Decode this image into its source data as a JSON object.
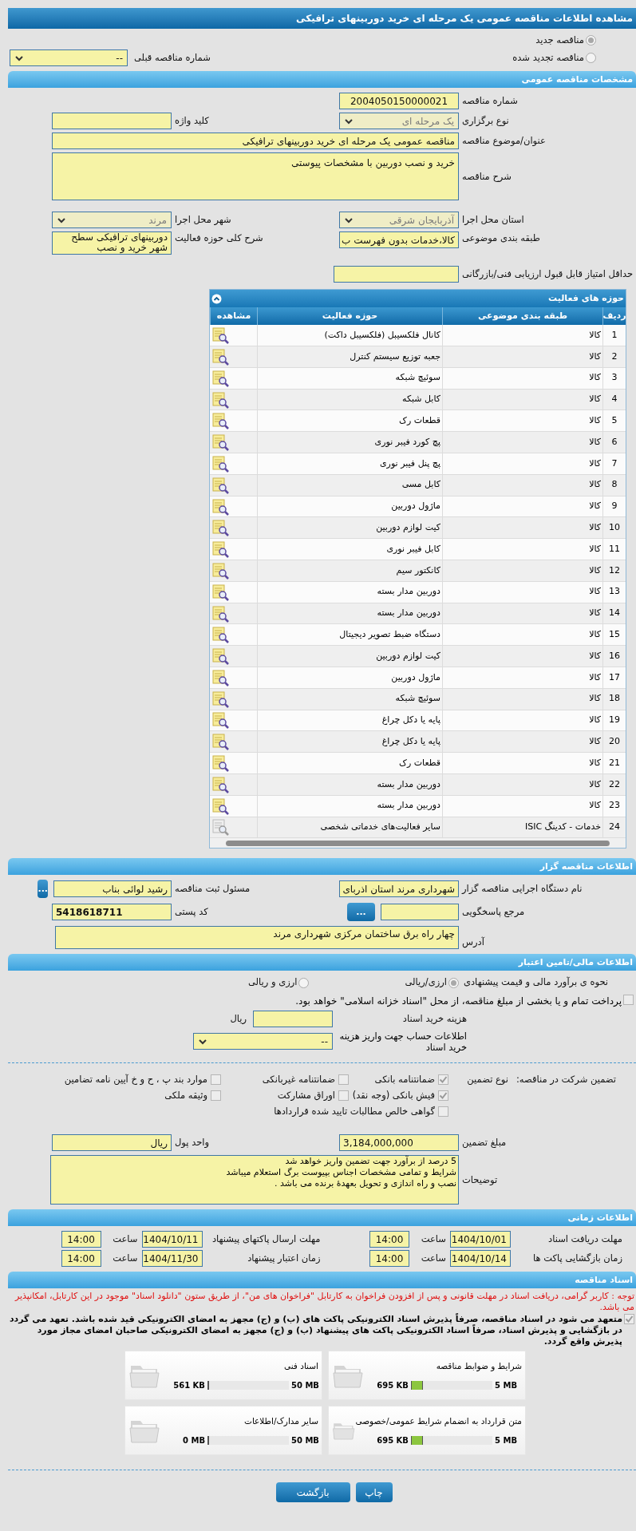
{
  "title": "مشاهده اطلاعات مناقصه عمومی یک مرحله ای خرید دوربینهای ترافیکی",
  "tender_types": [
    {
      "label": "مناقصه جدید",
      "selected": true
    },
    {
      "label": "مناقصه تجدید شده",
      "selected": false
    }
  ],
  "previous_tender": {
    "label": "شماره مناقصه قبلی",
    "value": "--",
    "disabled": false
  },
  "general": {
    "header": "مشخصات مناقصه عمومی",
    "tender_number": {
      "label": "شماره مناقصه",
      "value": "2004050150000021"
    },
    "holding_type": {
      "label": "نوع برگزاری",
      "value": "یک مرحله ای",
      "disabled": true
    },
    "keyword": {
      "label": "کلید واژه"
    },
    "subject": {
      "label": "عنوان/موضوع مناقصه",
      "value": "مناقصه عمومی یک مرحله ای خرید دوربینهای ترافیکی"
    },
    "description": {
      "label": "شرح مناقصه",
      "value": "خرید و نصب دوربین با مشخصات پیوستی"
    },
    "province": {
      "label": "استان محل اجرا",
      "value": "آذربایجان شرقی",
      "disabled": true
    },
    "city": {
      "label": "شهر محل اجرا",
      "value": "مرند",
      "disabled": true
    },
    "category": {
      "label": "طبقه بندی موضوعی",
      "value": "کالا،خدمات بدون فهرست ب"
    },
    "activity_scope": {
      "label": "شرح کلی حوزه فعالیت",
      "value": "دوربینهای ترافیکی سطح شهر خرید و نصب"
    },
    "min_score": {
      "label": "حداقل امتیاز قابل قبول ارزیابی فنی/بازرگانی"
    }
  },
  "activities": {
    "header": "حوزه های فعالیت",
    "columns": [
      "ردیف",
      "طبقه بندی موضوعی",
      "حوزه فعالیت",
      "مشاهده"
    ],
    "rows": [
      {
        "number": "1",
        "category": "کالا",
        "activity": "کانال فلکسیبل (فلکسیبل داکت)",
        "disabled": false
      },
      {
        "number": "2",
        "category": "کالا",
        "activity": "جعبه توزیع سیستم کنترل",
        "disabled": false
      },
      {
        "number": "3",
        "category": "کالا",
        "activity": "سوئیچ شبکه",
        "disabled": false
      },
      {
        "number": "4",
        "category": "کالا",
        "activity": "کابل شبکه",
        "disabled": false
      },
      {
        "number": "5",
        "category": "کالا",
        "activity": "قطعات رک",
        "disabled": false
      },
      {
        "number": "6",
        "category": "کالا",
        "activity": "پچ کورد فیبر نوری",
        "disabled": false
      },
      {
        "number": "7",
        "category": "کالا",
        "activity": "پچ پنل فیبر نوری",
        "disabled": false
      },
      {
        "number": "8",
        "category": "کالا",
        "activity": "کابل مسی",
        "disabled": false
      },
      {
        "number": "9",
        "category": "کالا",
        "activity": "ماژول دوربین",
        "disabled": false
      },
      {
        "number": "10",
        "category": "کالا",
        "activity": "کیت لوازم دوربین",
        "disabled": false
      },
      {
        "number": "11",
        "category": "کالا",
        "activity": "کابل فیبر نوری",
        "disabled": false
      },
      {
        "number": "12",
        "category": "کالا",
        "activity": "کانکتور سیم",
        "disabled": false
      },
      {
        "number": "13",
        "category": "کالا",
        "activity": "دوربین مدار بسته",
        "disabled": false
      },
      {
        "number": "14",
        "category": "کالا",
        "activity": "دوربین مدار بسته",
        "disabled": false
      },
      {
        "number": "15",
        "category": "کالا",
        "activity": "دستگاه ضبط تصویر دیجیتال",
        "disabled": false
      },
      {
        "number": "16",
        "category": "کالا",
        "activity": "کیت لوازم دوربین",
        "disabled": false
      },
      {
        "number": "17",
        "category": "کالا",
        "activity": "ماژول دوربین",
        "disabled": false
      },
      {
        "number": "18",
        "category": "کالا",
        "activity": "سوئیچ شبکه",
        "disabled": false
      },
      {
        "number": "19",
        "category": "کالا",
        "activity": "پایه یا دکل چراغ",
        "disabled": false
      },
      {
        "number": "20",
        "category": "کالا",
        "activity": "پایه یا دکل چراغ",
        "disabled": false
      },
      {
        "number": "21",
        "category": "کالا",
        "activity": "قطعات رک",
        "disabled": false
      },
      {
        "number": "22",
        "category": "کالا",
        "activity": "دوربین مدار بسته",
        "disabled": false
      },
      {
        "number": "23",
        "category": "کالا",
        "activity": "دوربین مدار بسته",
        "disabled": false
      },
      {
        "number": "24",
        "category": "خدمات - کدینگ ISIC",
        "activity": "سایر فعالیت‌های خدماتی شخصی",
        "disabled": true
      }
    ]
  },
  "organizer": {
    "header": "اطلاعات مناقصه گزار",
    "agency": {
      "label": "نام دستگاه اجرایی مناقصه گزار",
      "value": "شهرداری مرند استان اذربای"
    },
    "registrar": {
      "label": "مسئول ثبت مناقصه",
      "value": "رشید لوائی بناب",
      "button": "..."
    },
    "reference": {
      "label": "مرجع پاسخگویی",
      "button": "..."
    },
    "postal_code": {
      "label": "کد پستی",
      "value": "5418618711"
    },
    "address": {
      "label": "آدرس",
      "value": "چهار راه برق ساختمان مرکزی شهرداری مرند"
    }
  },
  "finance": {
    "header": "اطلاعات مالی/تامین اعتبار",
    "estimate": {
      "label": "نحوه ی برآورد مالی و قیمت پیشنهادی",
      "options": [
        {
          "label": "ارزی/ریالی",
          "selected": true
        },
        {
          "label": "ارزی و ریالی",
          "selected": false
        }
      ]
    },
    "treasury": {
      "label": "پرداخت تمام و یا بخشی از مبلغ مناقصه، از محل \"اسناد خزانه اسلامی\" خواهد بود.",
      "checked": false
    },
    "doc_fee": {
      "label": "هزینه خرید اسناد",
      "unit": "ریال"
    },
    "account": {
      "label": "اطلاعات حساب جهت واریز هزینه خرید اسناد",
      "value": "--",
      "disabled": false
    }
  },
  "guarantee": {
    "label": "تضمین شرکت در مناقصه:",
    "type_label": "نوع تضمین",
    "options": [
      {
        "label": "ضمانتنامه بانکی",
        "checked": true
      },
      {
        "label": "ضمانتنامه غیربانکی",
        "checked": false
      },
      {
        "label": "موارد بند پ ، ح و خ آیین نامه تضامین",
        "checked": false
      },
      {
        "label": "فیش بانکی (وجه نقد)",
        "checked": true
      },
      {
        "label": "اوراق مشارکت",
        "checked": false
      },
      {
        "label": "وثیقه ملکی",
        "checked": false
      },
      {
        "label": "گواهی خالص مطالبات تایید شده قراردادها",
        "checked": false
      }
    ],
    "amount": {
      "label": "مبلغ تضمین",
      "value": "3,184,000,000"
    },
    "currency": {
      "label": "واحد پول",
      "value": "ریال"
    },
    "notes": {
      "label": "توضیحات",
      "lines": [
        "5 درصد از برآورد جهت تضمین واریز خواهد شد",
        "شرایط و تمامی مشخصات اجناس بپیوست برگ استعلام میباشد",
        "نصب و راه اندازی و تحویل بعهدهٔ برنده می باشد ."
      ]
    }
  },
  "times": {
    "header": "اطلاعات زمانی",
    "items": [
      {
        "label": "مهلت دریافت اسناد",
        "date": "1404/10/01",
        "time_label": "ساعت",
        "time": "14:00"
      },
      {
        "label": "مهلت ارسال پاکتهای پیشنهاد",
        "date": "1404/10/11",
        "time_label": "ساعت",
        "time": "14:00"
      },
      {
        "label": "زمان بازگشایی پاکت ها",
        "date": "1404/10/14",
        "time_label": "ساعت",
        "time": "14:00"
      },
      {
        "label": "زمان اعتبار پیشنهاد",
        "date": "1404/11/30",
        "time_label": "ساعت",
        "time": "14:00"
      }
    ]
  },
  "documents": {
    "header": "اسناد مناقصه",
    "notice": "توجه : کاربر گرامی، دریافت اسناد در مهلت قانونی و پس از افزودن فراخوان به کارتابل \"فراخوان های من\"، از طریق ستون \"دانلود اسناد\" موجود در این کارتابل، امکانپذیر می باشد.",
    "commitment": {
      "text": "متعهد می شود در اسناد مناقصه، صرفاً پذیرش اسناد الکترونیکی پاکت های (ب) و (ج) مجهز به امضای الکترونیکی قید شده باشد. تعهد می گردد در بازگشایی و پذیرش اسناد، صرفاً اسناد الکترونیکی پاکت های پیشنهاد (ب) و (ج) مجهز به امضای الکترونیکی صاحبان امضای مجاز مورد پذیرش واقع گردد.",
      "checked": true
    },
    "files": [
      {
        "name": "شرایط و ضوابط مناقصه",
        "size": "695 KB",
        "limit": "5 MB",
        "level": 0.14
      },
      {
        "name": "اسناد فنی",
        "size": "561 KB",
        "limit": "50 MB",
        "level": 0.011
      },
      {
        "name": "متن قرارداد به انضمام شرایط عمومی/خصوصی",
        "size": "695 KB",
        "limit": "5 MB",
        "level": 0.14
      },
      {
        "name": "سایر مدارک/اطلاعات",
        "size": "0 MB",
        "limit": "50 MB",
        "level": 0
      }
    ]
  },
  "buttons": [
    {
      "label": "چاپ"
    },
    {
      "label": "بازگشت"
    }
  ]
}
